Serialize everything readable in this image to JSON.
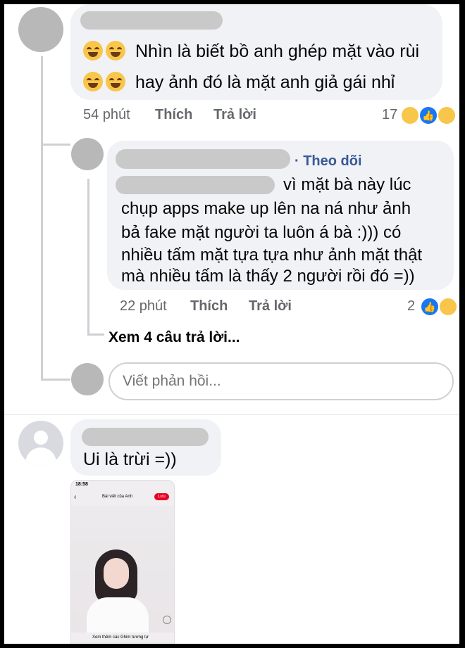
{
  "comments": [
    {
      "lines": [
        "Nhìn là biết bồ anh ghép mặt vào rùi",
        "hay ảnh đó là mặt anh giả gái nhỉ"
      ],
      "time": "54 phút",
      "like_label": "Thích",
      "reply_label": "Trả lời",
      "reaction_count": "17"
    },
    {
      "follow_label": "· Theo dõi",
      "lines": [
        "vì mặt bà này lúc",
        "chụp apps make up lên na ná như ảnh",
        "bả fake mặt người ta luôn á bà :))) có",
        "nhiều tấm mặt tựa tựa như ảnh mặt thật",
        "mà nhiều tấm là thấy 2 người rồi đó =))"
      ],
      "time": "22 phút",
      "like_label": "Thích",
      "reply_label": "Trả lời",
      "reaction_count": "2"
    },
    {
      "lines": [
        "Ui là trừi =))"
      ]
    }
  ],
  "view_replies": "Xem 4 câu trả lời...",
  "reply_input": {
    "placeholder": "Viết phản hồi..."
  },
  "attachment": {
    "status_time": "18:58",
    "header_title": "Bài viết của Anh",
    "save_label": "Lưu",
    "footer_text": "Xem thêm các Ghim tương tự"
  },
  "icons": [
    "rofl-emoji-icon",
    "like-reaction-icon",
    "haha-reaction-icon",
    "sad-reaction-icon",
    "default-avatar-icon",
    "back-arrow-icon",
    "pin-icon"
  ],
  "colors": {
    "link": "#385898",
    "meta": "#65676b",
    "bubble": "#f0f2f5",
    "like": "#1877f2"
  }
}
